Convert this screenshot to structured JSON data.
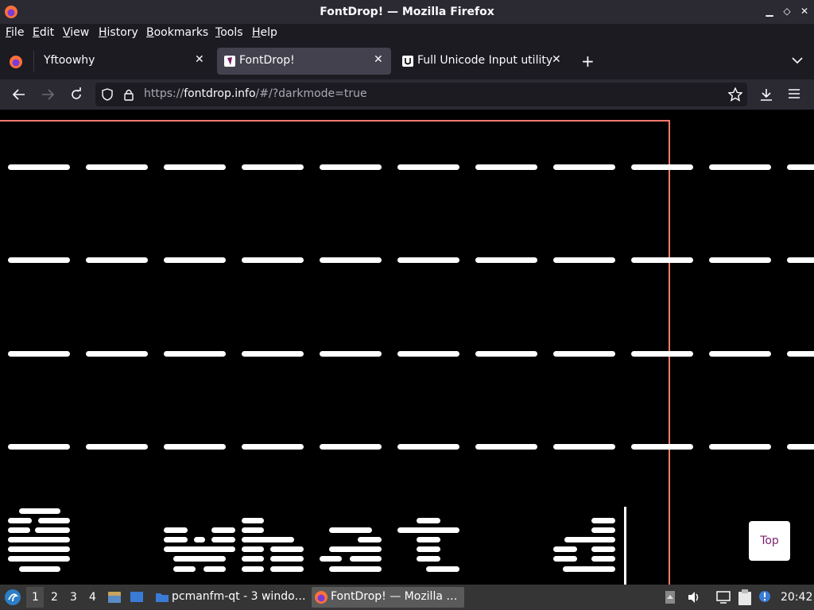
{
  "window": {
    "title": "FontDrop! — Mozilla Firefox"
  },
  "menu": {
    "items": [
      "File",
      "Edit",
      "View",
      "History",
      "Bookmarks",
      "Tools",
      "Help"
    ]
  },
  "tabs": [
    {
      "label": "Yftoowhy",
      "active": false
    },
    {
      "label": "FontDrop!",
      "active": true
    },
    {
      "label": "Full Unicode Input utility",
      "active": false
    }
  ],
  "nav": {
    "url_prefix": "https://",
    "url_host": "fontdrop.info",
    "url_path": "/#/?darkmode=true"
  },
  "content": {
    "top_button": "Top"
  },
  "taskbar": {
    "workspaces": [
      "1",
      "2",
      "3",
      "4"
    ],
    "active_workspace": "1",
    "tasks": [
      "pcmanfm-qt - 3 windo…",
      "FontDrop! — Mozilla …"
    ],
    "clock": "20:42"
  },
  "colors": {
    "accent_red": "#ff7a6b",
    "top_button_text": "#7a1f6a",
    "firefox_orange": "#ff7139"
  }
}
